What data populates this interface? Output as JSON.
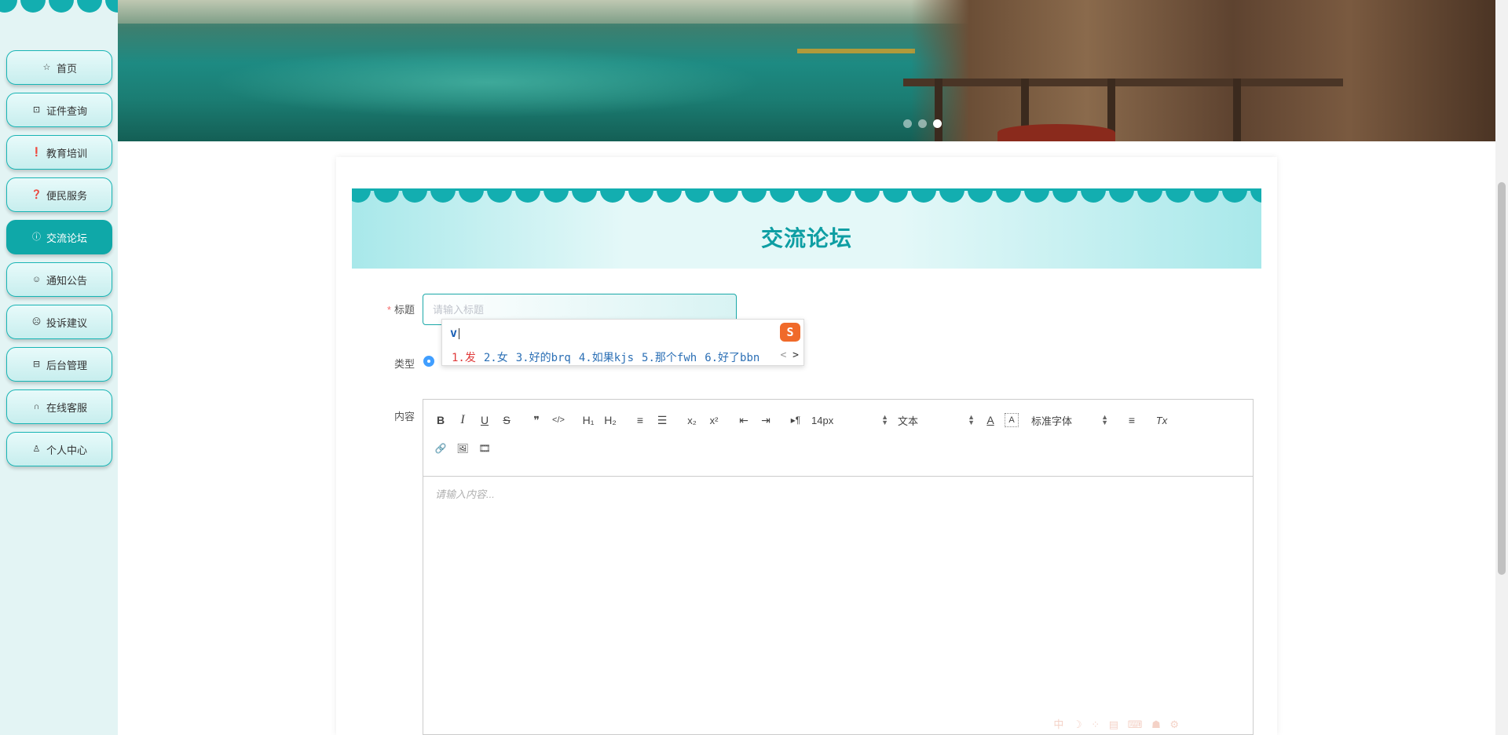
{
  "sidebar": {
    "items": [
      {
        "label": "首页",
        "icon": "star-icon",
        "active": false
      },
      {
        "label": "证件查询",
        "icon": "bag-icon",
        "active": false
      },
      {
        "label": "教育培训",
        "icon": "alert-icon",
        "active": false
      },
      {
        "label": "便民服务",
        "icon": "question-icon",
        "active": false
      },
      {
        "label": "交流论坛",
        "icon": "info-icon",
        "active": true
      },
      {
        "label": "通知公告",
        "icon": "smile-icon",
        "active": false
      },
      {
        "label": "投诉建议",
        "icon": "sad-icon",
        "active": false
      },
      {
        "label": "后台管理",
        "icon": "lock-icon",
        "active": false
      },
      {
        "label": "在线客服",
        "icon": "headset-icon",
        "active": false
      },
      {
        "label": "个人中心",
        "icon": "user-icon",
        "active": false
      }
    ]
  },
  "banner": {
    "slide_count": 3,
    "active_slide": 3
  },
  "page": {
    "title": "交流论坛"
  },
  "form": {
    "title_label": "标题",
    "title_required_mark": "*",
    "title_placeholder": "请输入标题",
    "type_label": "类型",
    "content_label": "内容",
    "content_placeholder": "请输入内容..."
  },
  "ime": {
    "code": "v",
    "candidates": [
      "1.发",
      "2.女",
      "3.好的brq",
      "4.如果kjs",
      "5.那个fwh",
      "6.好了bbn"
    ],
    "prev": "<",
    "next": ">"
  },
  "editor": {
    "toolbar": {
      "bold": "B",
      "italic": "I",
      "underline": "U",
      "strike": "S",
      "blockquote": "❞",
      "code": "</>",
      "h1": "H₁",
      "h2": "H₂",
      "ordered_list": "≡",
      "bullet_list": "☰",
      "subscript": "x₂",
      "superscript": "x²",
      "outdent": "⇤",
      "indent": "⇥",
      "direction": "▸¶",
      "font_size": "14px",
      "header_select": "文本",
      "font_color": "A",
      "bg_color": "A",
      "font_family": "标准字体",
      "align": "≡",
      "clean": "Tx",
      "link": "🔗",
      "image": "🖼",
      "video": "🎞"
    }
  },
  "ime_tray": "中 ☽ ⁘ ▤ ⌨ ☗ ⚙",
  "colors": {
    "accent": "#0fa8a8",
    "title": "#0e9ea3",
    "sidebar_bg": "#e3f4f4"
  }
}
